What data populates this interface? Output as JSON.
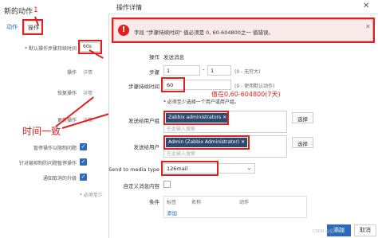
{
  "background": {
    "title": "新的动作",
    "annotation_1": "1",
    "tab_action": "动作",
    "tab_operations": "操作",
    "default_step_label": "* 默认操作步骤持续时间",
    "default_step_value": "60s",
    "ops_label": "操作",
    "ops_detail": "详情",
    "recovery_label": "恢复操作",
    "recovery_detail": "详情",
    "update_label": "更新操作",
    "update_detail": "详情",
    "annotation_same_time": "时间一致",
    "pause_label": "暂停操作以限制问题",
    "pause_label2": "针对被抑制的问题暂停操作",
    "notify_cancel": "通知取消的升级",
    "required_note": "* 必须至少"
  },
  "dialog": {
    "title": "操作详情",
    "close": "✕",
    "error_icon": "!",
    "error_text": "字段 \"步骤持续时间\" 值必须是 0, 60-604800之一 值错误。",
    "error_close": "✕",
    "operation_label": "操作",
    "operation_value": "发送消息",
    "steps_label": "步骤",
    "step_from": "1",
    "step_sep": "-",
    "step_to": "1",
    "step_hint": "(0 - 无穷大)",
    "duration_label": "步骤持续时间",
    "duration_value": "60",
    "duration_hint": "(0 - 使用默认动作)",
    "annotation_value": "值在0,60-604800(7天)",
    "required_hint": "* 必须至少选择一个用户或用户组。",
    "send_groups_label": "发送给用户组",
    "group_tag": "Zabbix administrators",
    "group_input_placeholder": "在此输入搜索",
    "select_btn_1": "选择",
    "send_users_label": "发送给用户",
    "user_tag": "Admin (Zabbix Administrator)",
    "user_input_placeholder": "在此输入搜索",
    "select_btn_2": "选择",
    "media_label": "Send to media type",
    "media_value": "126mail",
    "custom_msg_label": "自定义消息内容",
    "conditions_label": "条件",
    "cond_col_label": "标签",
    "cond_col_name": "名称",
    "cond_col_action": "动作",
    "cond_add": "添加",
    "add_button": "添加",
    "cancel_button": "取消",
    "watermark": "CSDN @星兴大人"
  },
  "colors": {
    "accent": "#2a6ab8",
    "annotation_red": "#e0201c",
    "tag_bg": "#2e4a6e"
  }
}
